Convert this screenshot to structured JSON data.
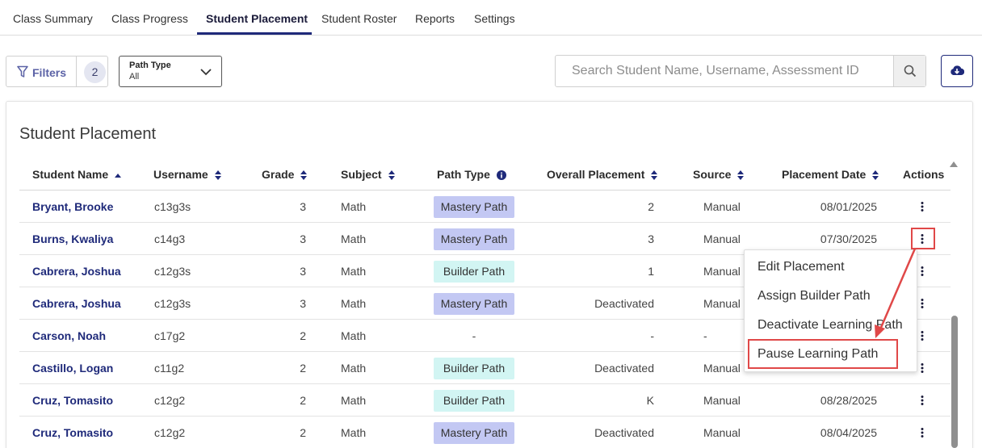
{
  "tabs": [
    {
      "label": "Class Summary",
      "active": false
    },
    {
      "label": "Class Progress",
      "active": false
    },
    {
      "label": "Student Placement",
      "active": true
    },
    {
      "label": "Student Roster",
      "active": false
    },
    {
      "label": "Reports",
      "active": false
    },
    {
      "label": "Settings",
      "active": false
    }
  ],
  "toolbar": {
    "filters_label": "Filters",
    "filters_count": "2",
    "path_type_label": "Path Type",
    "path_type_value": "All",
    "search_placeholder": "Search Student Name, Username, Assessment ID"
  },
  "card": {
    "title": "Student Placement"
  },
  "table": {
    "headers": {
      "student_name": "Student Name",
      "username": "Username",
      "grade": "Grade",
      "subject": "Subject",
      "path_type": "Path Type",
      "overall_placement": "Overall Placement",
      "source": "Source",
      "placement_date": "Placement Date",
      "actions": "Actions"
    },
    "rows": [
      {
        "name": "Bryant, Brooke",
        "username": "c13g3s",
        "grade": "3",
        "subject": "Math",
        "path": "Mastery Path",
        "path_kind": "mastery",
        "placement": "2",
        "source": "Manual",
        "date": "08/01/2025"
      },
      {
        "name": "Burns, Kwaliya",
        "username": "c14g3",
        "grade": "3",
        "subject": "Math",
        "path": "Mastery Path",
        "path_kind": "mastery",
        "placement": "3",
        "source": "Manual",
        "date": "07/30/2025"
      },
      {
        "name": "Cabrera, Joshua",
        "username": "c12g3s",
        "grade": "3",
        "subject": "Math",
        "path": "Builder Path",
        "path_kind": "builder",
        "placement": "1",
        "source": "Manual",
        "date": ""
      },
      {
        "name": "Cabrera, Joshua",
        "username": "c12g3s",
        "grade": "3",
        "subject": "Math",
        "path": "Mastery Path",
        "path_kind": "mastery",
        "placement": "Deactivated",
        "source": "Manual",
        "date": ""
      },
      {
        "name": "Carson, Noah",
        "username": "c17g2",
        "grade": "2",
        "subject": "Math",
        "path": "-",
        "path_kind": "none",
        "placement": "-",
        "source": "-",
        "date": ""
      },
      {
        "name": "Castillo, Logan",
        "username": "c11g2",
        "grade": "2",
        "subject": "Math",
        "path": "Builder Path",
        "path_kind": "builder",
        "placement": "Deactivated",
        "source": "Manual",
        "date": ""
      },
      {
        "name": "Cruz, Tomasito",
        "username": "c12g2",
        "grade": "2",
        "subject": "Math",
        "path": "Builder Path",
        "path_kind": "builder",
        "placement": "K",
        "source": "Manual",
        "date": "08/28/2025"
      },
      {
        "name": "Cruz, Tomasito",
        "username": "c12g2",
        "grade": "2",
        "subject": "Math",
        "path": "Mastery Path",
        "path_kind": "mastery",
        "placement": "Deactivated",
        "source": "Manual",
        "date": "08/04/2025"
      }
    ]
  },
  "menu": {
    "items": [
      "Edit Placement",
      "Assign Builder Path",
      "Deactivate Learning Path",
      "Pause Learning Path"
    ]
  },
  "colors": {
    "brand": "#1f2a7a",
    "mastery_badge": "#c3c8f3",
    "builder_badge": "#d2f5f3",
    "highlight": "#e04848"
  }
}
